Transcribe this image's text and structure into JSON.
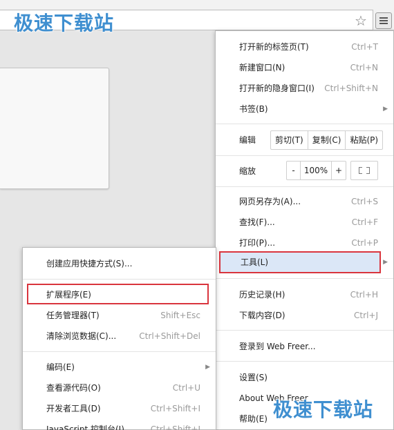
{
  "watermark": "极速下载站",
  "page": {},
  "main_menu": {
    "new_tab": {
      "label": "打开新的标签页(T)",
      "shortcut": "Ctrl+T"
    },
    "new_window": {
      "label": "新建窗口(N)",
      "shortcut": "Ctrl+N"
    },
    "new_incognito": {
      "label": "打开新的隐身窗口(I)",
      "shortcut": "Ctrl+Shift+N"
    },
    "bookmarks": {
      "label": "书签(B)"
    },
    "edit": {
      "label": "编辑",
      "cut": "剪切(T)",
      "copy": "复制(C)",
      "paste": "粘贴(P)"
    },
    "zoom": {
      "label": "缩放",
      "minus": "-",
      "value": "100%",
      "plus": "+"
    },
    "save_as": {
      "label": "网页另存为(A)...",
      "shortcut": "Ctrl+S"
    },
    "find": {
      "label": "查找(F)...",
      "shortcut": "Ctrl+F"
    },
    "print": {
      "label": "打印(P)...",
      "shortcut": "Ctrl+P"
    },
    "tools": {
      "label": "工具(L)"
    },
    "history": {
      "label": "历史记录(H)",
      "shortcut": "Ctrl+H"
    },
    "downloads": {
      "label": "下载内容(D)",
      "shortcut": "Ctrl+J"
    },
    "sign_in": {
      "label": "登录到 Web Freer..."
    },
    "settings": {
      "label": "设置(S)"
    },
    "about": {
      "label": "About Web Freer"
    },
    "help": {
      "label": "帮助(E)"
    }
  },
  "sub_menu": {
    "create_shortcut": {
      "label": "创建应用快捷方式(S)..."
    },
    "extensions": {
      "label": "扩展程序(E)"
    },
    "task_manager": {
      "label": "任务管理器(T)",
      "shortcut": "Shift+Esc"
    },
    "clear_data": {
      "label": "清除浏览数据(C)...",
      "shortcut": "Ctrl+Shift+Del"
    },
    "encoding": {
      "label": "编码(E)"
    },
    "view_source": {
      "label": "查看源代码(O)",
      "shortcut": "Ctrl+U"
    },
    "dev_tools": {
      "label": "开发者工具(D)",
      "shortcut": "Ctrl+Shift+I"
    },
    "js_console": {
      "label": "JavaScript 控制台(J)",
      "shortcut": "Ctrl+Shift+J"
    }
  },
  "colors": {
    "highlight_border": "#d9343d",
    "watermark": "#3f8fd0"
  }
}
